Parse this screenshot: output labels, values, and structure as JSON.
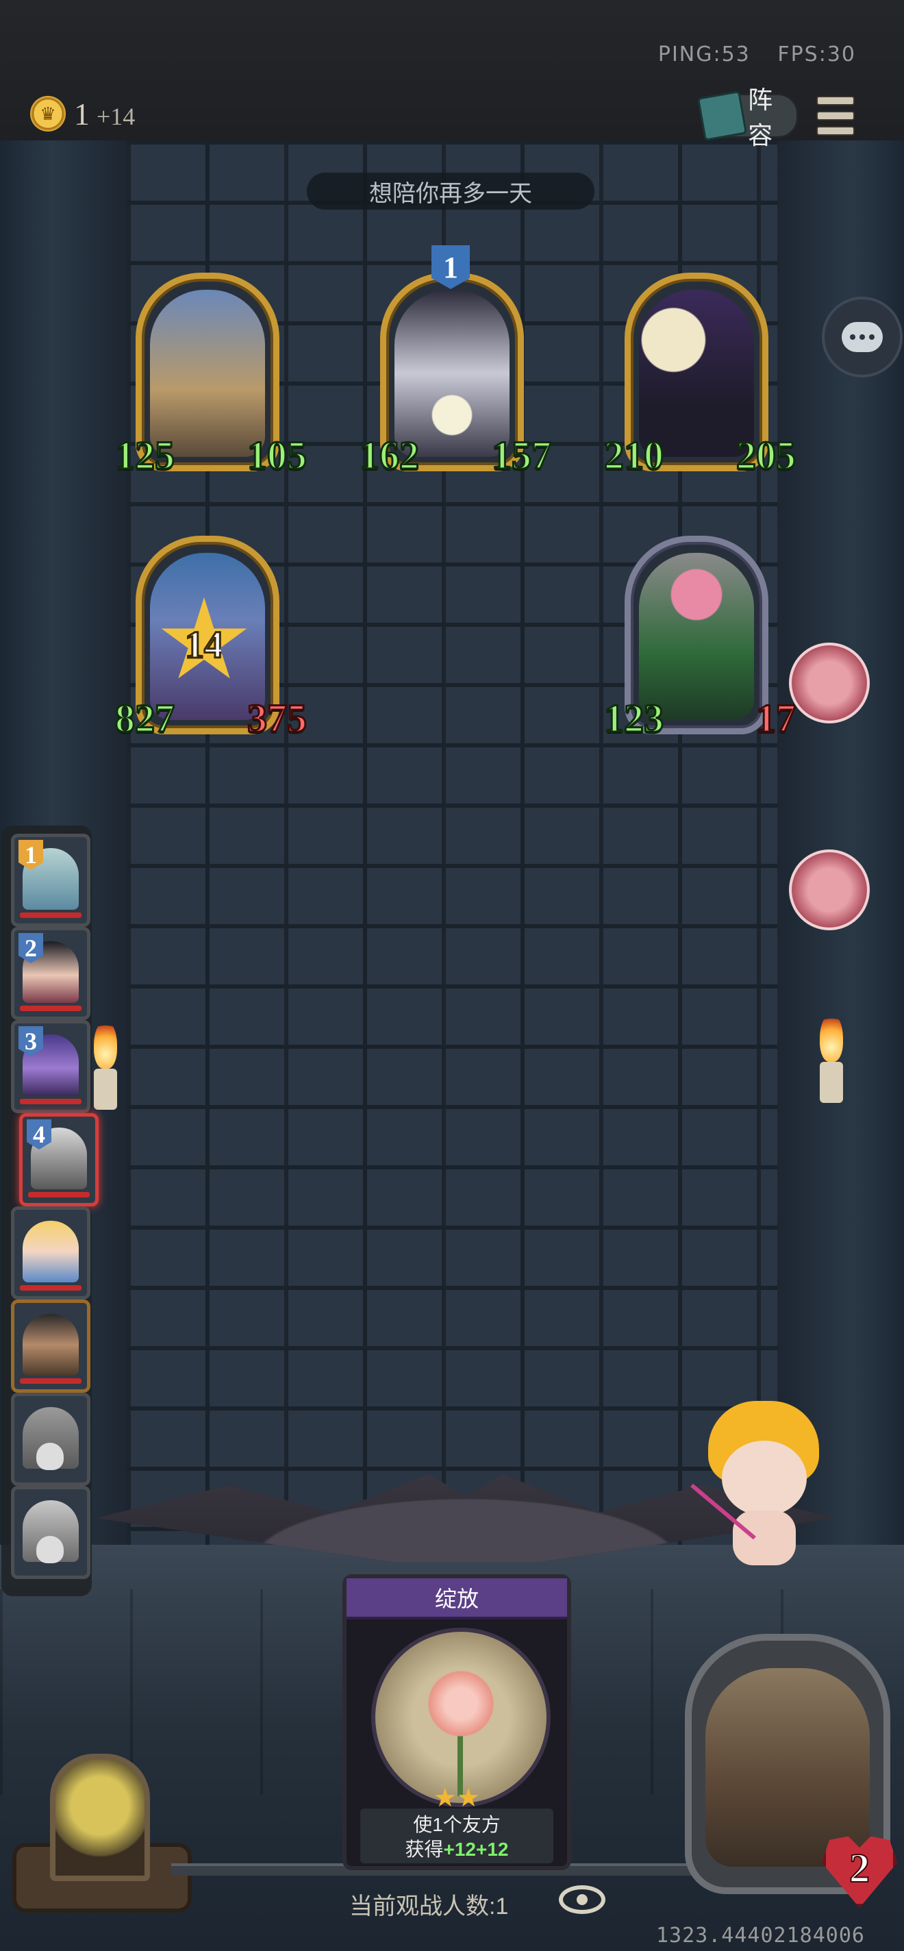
{
  "network": {
    "ping": "PING:53",
    "fps": "FPS:30"
  },
  "gold": {
    "amount": "1",
    "income": "+14"
  },
  "header": {
    "lineup_label": "阵容"
  },
  "banner": {
    "text": "想陪你再多一天"
  },
  "opponent_board": [
    {
      "name": "king-wizard",
      "attack": "125",
      "health": "105",
      "health_damaged": false
    },
    {
      "name": "moon-witch",
      "attack": "162",
      "health": "157",
      "health_damaged": false,
      "tier_badge": "1"
    },
    {
      "name": "moon-general",
      "attack": "210",
      "health": "205",
      "health_damaged": false
    }
  ],
  "player_board": [
    {
      "name": "blue-hair-elf",
      "attack": "827",
      "health": "375",
      "health_damaged": true,
      "star_level": "14"
    },
    {
      "name": "flower-dryad",
      "attack": "123",
      "health": "17",
      "health_damaged": true
    }
  ],
  "roster": [
    {
      "rank": "1",
      "badge_color": "#e8a53a"
    },
    {
      "rank": "2",
      "badge_color": "#4a78b8"
    },
    {
      "rank": "3",
      "badge_color": "#4a78b8"
    },
    {
      "rank": "4",
      "badge_color": "#4a78b8",
      "active": true
    },
    {
      "rank": ""
    },
    {
      "rank": ""
    },
    {
      "rank": "",
      "eliminated": true
    },
    {
      "rank": "",
      "eliminated": true
    }
  ],
  "spell_card": {
    "title": "绽放",
    "stars": "★★",
    "desc_line1": "使1个友方",
    "desc_prefix": "获得",
    "buff_attack": "+12",
    "buff_health": "+12"
  },
  "spectators": {
    "label": "当前观战人数:1"
  },
  "hero": {
    "health": "2"
  },
  "coords_text": "1323.44402184006",
  "colors": {
    "heal_green": "#9df07a",
    "damage_red": "#ff6b6b",
    "gold_frame": "#c99a34",
    "spell_purple": "#5b3f87"
  }
}
